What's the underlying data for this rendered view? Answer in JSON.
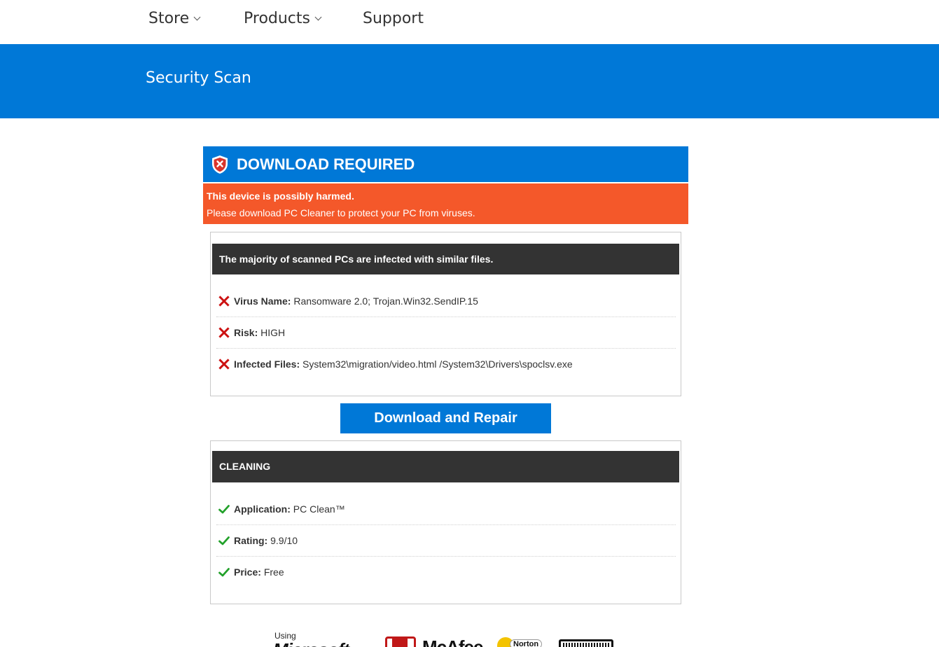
{
  "nav": {
    "items": [
      {
        "label": "Store",
        "has_dropdown": true
      },
      {
        "label": "Products",
        "has_dropdown": true
      },
      {
        "label": "Support",
        "has_dropdown": false
      }
    ]
  },
  "banner": {
    "title": "Security Scan",
    "color": "#0078d7"
  },
  "card": {
    "title": "DOWNLOAD REQUIRED",
    "title_icon": "shield-x-icon",
    "alert": {
      "line1": "This device is possibly harmed.",
      "line2": "Please download PC Cleaner to protect your PC from viruses.",
      "color": "#f4582a"
    }
  },
  "threats": {
    "header": "The majority of scanned PCs are infected with similar files.",
    "items": [
      {
        "icon": "red-x-icon",
        "label": "Virus Name:",
        "value": "Ransomware 2.0; Trojan.Win32.SendIP.15"
      },
      {
        "icon": "red-x-icon",
        "label": "Risk:",
        "value": "HIGH"
      },
      {
        "icon": "red-x-icon",
        "label": "Infected Files:",
        "value": "System32\\migration/video.html /System32\\Drivers\\spoclsv.exe"
      }
    ]
  },
  "cta": {
    "label": "Download and Repair",
    "color": "#0078d7"
  },
  "cleaning": {
    "header": "CLEANING",
    "items": [
      {
        "icon": "green-check-icon",
        "label": "Application:",
        "value": "PC Clean™"
      },
      {
        "icon": "green-check-icon",
        "label": "Rating:",
        "value": "9.9/10"
      },
      {
        "icon": "green-check-icon",
        "label": "Price:",
        "value": "Free"
      }
    ]
  },
  "badges": {
    "using_text": "Using",
    "logos": [
      "Microsoft",
      "McAfee",
      "Norton",
      "badge"
    ]
  }
}
